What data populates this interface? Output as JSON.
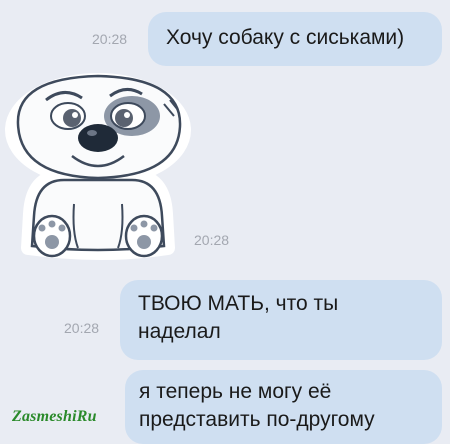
{
  "messages": [
    {
      "text": "Хочу собаку с сиськами)",
      "time": "20:28"
    },
    {
      "sticker": "white-dog-sticker",
      "time": "20:28"
    },
    {
      "text": "ТВОЮ МАТЬ, что ты наделал",
      "time": "20:28"
    },
    {
      "text": "я теперь не могу её представить по-другому"
    }
  ],
  "watermark": "ZasmeshiRu",
  "colors": {
    "background": "#e9ecf3",
    "bubble": "#cfdff1",
    "timestamp": "#a3a7b0",
    "watermark": "#2a8a2a"
  }
}
